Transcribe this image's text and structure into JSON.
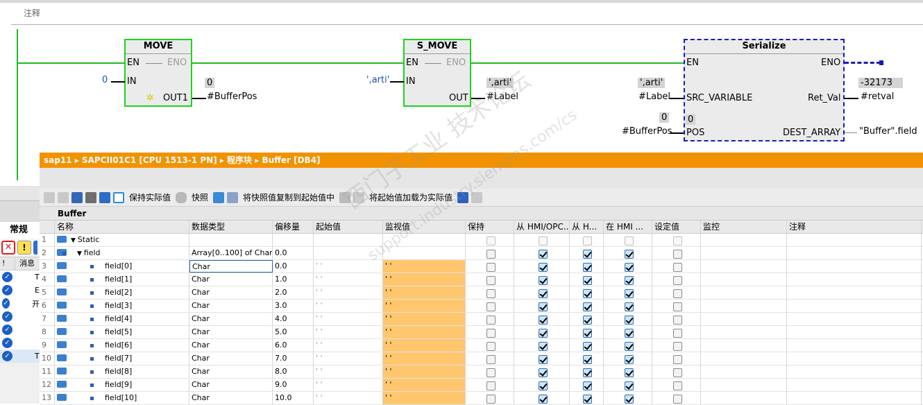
{
  "comment_label": "注释",
  "move": {
    "title": "MOVE",
    "en": "EN",
    "eno": "ENO",
    "in": "IN",
    "out1": "OUT1",
    "in_value": "0",
    "out_value": "0",
    "out_var": "#BufferPos"
  },
  "smove": {
    "title": "S_MOVE",
    "en": "EN",
    "eno": "ENO",
    "in": "IN",
    "out": "OUT",
    "in_value": "',arti'",
    "out_value": "',arti'",
    "out_var": "#Label"
  },
  "serialize": {
    "title": "Serialize",
    "en": "EN",
    "eno": "ENO",
    "src": "SRC_VARIABLE",
    "ret": "Ret_Val",
    "pos": "POS",
    "dest": "DEST_ARRAY",
    "src_value": "',arti'",
    "src_var": "#Label",
    "ret_value": "-32173",
    "ret_var": "#retval",
    "pos_value": "0",
    "pos_var": "#BufferPos",
    "pos_inner": "0",
    "dest_var": "\"Buffer\".field"
  },
  "db": {
    "breadcrumb": [
      "sap11",
      "SAPCII01C1 [CPU 1513-1 PN]",
      "程序块",
      "Buffer [DB4]"
    ],
    "toolbar": {
      "keep": "保持实际值",
      "snapshot": "快照",
      "copy": "将快照值复制到起始值中",
      "load": "将起始值加载为实际值"
    },
    "caption": "Buffer",
    "columns": [
      "",
      "名称",
      "数据类型",
      "偏移量",
      "起始值",
      "监视值",
      "保持",
      "从 HMI/OPC...",
      "从 H...",
      "在 HMI ...",
      "设定值",
      "监控",
      "注释"
    ],
    "rows": [
      {
        "n": "1",
        "name": "Static",
        "type": "",
        "off": "",
        "start": "",
        "mon": "",
        "level": 0,
        "exp": true,
        "ret": "dis",
        "a": "dis",
        "b": "dis",
        "c": "dis",
        "d": "dis"
      },
      {
        "n": "2",
        "name": "field",
        "type": "Array[0..100] of Char",
        "off": "0.0",
        "start": "",
        "mon": "",
        "level": 1,
        "exp": true,
        "ret": "off",
        "a": "on",
        "b": "on",
        "c": "on",
        "d": "off"
      },
      {
        "n": "3",
        "name": "field[0]",
        "type": "Char",
        "off": "0.0",
        "start": "' '",
        "mon": "' '",
        "level": 2,
        "ret": "off",
        "a": "on",
        "b": "on",
        "c": "on",
        "d": "off"
      },
      {
        "n": "4",
        "name": "field[1]",
        "type": "Char",
        "off": "1.0",
        "start": "' '",
        "mon": "' '",
        "level": 2,
        "ret": "off",
        "a": "on",
        "b": "on",
        "c": "on",
        "d": "off"
      },
      {
        "n": "5",
        "name": "field[2]",
        "type": "Char",
        "off": "2.0",
        "start": "' '",
        "mon": "' '",
        "level": 2,
        "ret": "off",
        "a": "on",
        "b": "on",
        "c": "on",
        "d": "off"
      },
      {
        "n": "6",
        "name": "field[3]",
        "type": "Char",
        "off": "3.0",
        "start": "' '",
        "mon": "' '",
        "level": 2,
        "ret": "off",
        "a": "on",
        "b": "on",
        "c": "on",
        "d": "off"
      },
      {
        "n": "7",
        "name": "field[4]",
        "type": "Char",
        "off": "4.0",
        "start": "' '",
        "mon": "' '",
        "level": 2,
        "ret": "off",
        "a": "on",
        "b": "on",
        "c": "on",
        "d": "off"
      },
      {
        "n": "8",
        "name": "field[5]",
        "type": "Char",
        "off": "5.0",
        "start": "' '",
        "mon": "' '",
        "level": 2,
        "ret": "off",
        "a": "on",
        "b": "on",
        "c": "on",
        "d": "off"
      },
      {
        "n": "9",
        "name": "field[6]",
        "type": "Char",
        "off": "6.0",
        "start": "' '",
        "mon": "' '",
        "level": 2,
        "ret": "off",
        "a": "on",
        "b": "on",
        "c": "on",
        "d": "off"
      },
      {
        "n": "10",
        "name": "field[7]",
        "type": "Char",
        "off": "7.0",
        "start": "' '",
        "mon": "' '",
        "level": 2,
        "ret": "off",
        "a": "on",
        "b": "on",
        "c": "on",
        "d": "off"
      },
      {
        "n": "11",
        "name": "field[8]",
        "type": "Char",
        "off": "8.0",
        "start": "' '",
        "mon": "' '",
        "level": 2,
        "ret": "off",
        "a": "on",
        "b": "on",
        "c": "on",
        "d": "off"
      },
      {
        "n": "12",
        "name": "field[9]",
        "type": "Char",
        "off": "9.0",
        "start": "' '",
        "mon": "' '",
        "level": 2,
        "ret": "off",
        "a": "on",
        "b": "on",
        "c": "on",
        "d": "off"
      },
      {
        "n": "13",
        "name": "field[10]",
        "type": "Char",
        "off": "10.0",
        "start": "' '",
        "mon": "' '",
        "level": 2,
        "ret": "off",
        "a": "on",
        "b": "on",
        "c": "on",
        "d": "off"
      }
    ]
  },
  "left_panel": {
    "tab": "常规",
    "msg_col": "消息",
    "col_excl": "!",
    "rows": [
      "T",
      "E",
      "开",
      "",
      "",
      "",
      "T"
    ]
  },
  "watermark": {
    "line1": "西门子工业 技术论坛",
    "line2": "support.industry.siemens.com/cs"
  },
  "colors": {
    "wire": "#22bb22",
    "orange": "#f39200",
    "monitor": "#ffc66e"
  }
}
